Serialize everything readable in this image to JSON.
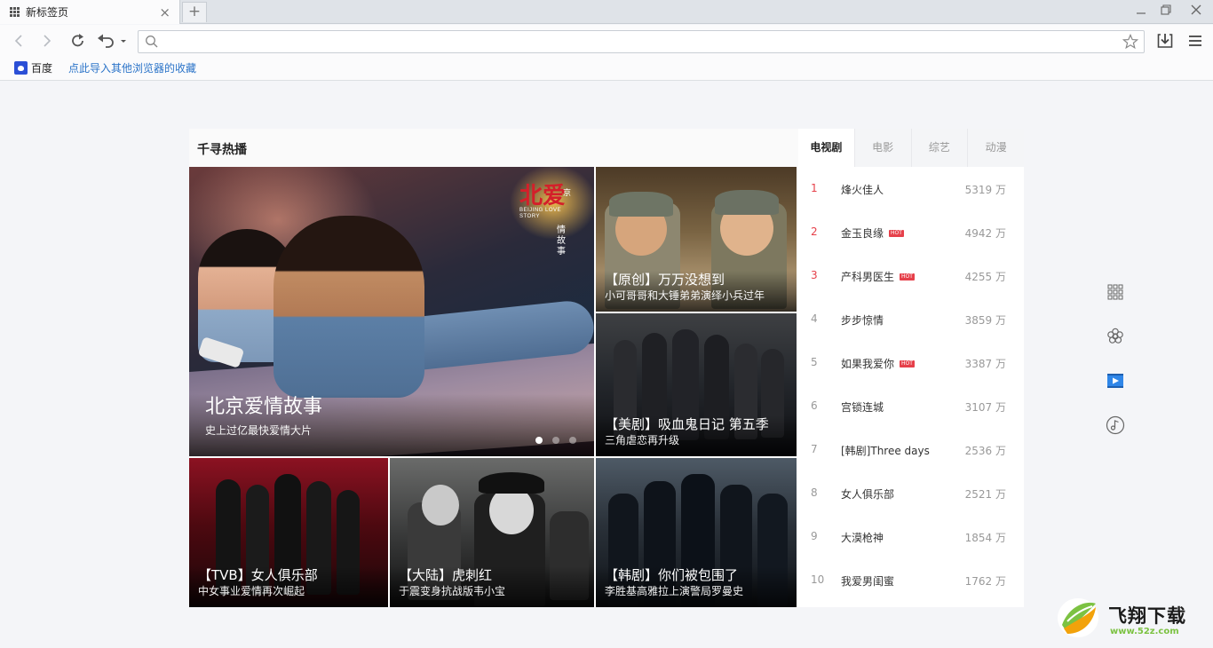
{
  "tab": {
    "title": "新标签页",
    "close": "×",
    "new": "+"
  },
  "window": {
    "minimize": "—",
    "restore": "❐",
    "close": "✕"
  },
  "address": {
    "value": "",
    "placeholder": ""
  },
  "bookmarks": [
    {
      "label": "百度"
    },
    {
      "label": "点此导入其他浏览器的收藏"
    }
  ],
  "panel": {
    "title": "千寻热播",
    "feature": {
      "title": "北京爱情故事",
      "subtitle": "史上过亿最快爱情大片",
      "logo": {
        "main": "北爱",
        "small": "京",
        "english": "BEIJING LOVE STORY",
        "vertical": "情故事"
      },
      "slides": 3,
      "active_slide": 1
    },
    "tiles": [
      {
        "title": "【原创】万万没想到",
        "subtitle": "小可哥哥和大锤弟弟演绎小兵过年"
      },
      {
        "title": "【美剧】吸血鬼日记 第五季",
        "subtitle": "三角虐恋再升级"
      },
      {
        "title": "【TVB】女人俱乐部",
        "subtitle": "中女事业爱情再次崛起"
      },
      {
        "title": "【大陆】虎刺红",
        "subtitle": "于震变身抗战版韦小宝"
      },
      {
        "title": "【韩剧】你们被包围了",
        "subtitle": "李胜基高雅拉上演警局罗曼史"
      }
    ]
  },
  "ranking": {
    "tabs": [
      "电视剧",
      "电影",
      "综艺",
      "动漫"
    ],
    "active_tab": 0,
    "items": [
      {
        "rank": "1",
        "name": "烽火佳人",
        "count": "5319 万",
        "hot": false
      },
      {
        "rank": "2",
        "name": "金玉良缘",
        "count": "4942 万",
        "hot": true
      },
      {
        "rank": "3",
        "name": "产科男医生",
        "count": "4255 万",
        "hot": true
      },
      {
        "rank": "4",
        "name": "步步惊情",
        "count": "3859 万",
        "hot": false
      },
      {
        "rank": "5",
        "name": "如果我爱你",
        "count": "3387 万",
        "hot": true
      },
      {
        "rank": "6",
        "name": "宫锁连城",
        "count": "3107 万",
        "hot": false
      },
      {
        "rank": "7",
        "name": "[韩剧]Three days",
        "count": "2536 万",
        "hot": false
      },
      {
        "rank": "8",
        "name": "女人俱乐部",
        "count": "2521 万",
        "hot": false
      },
      {
        "rank": "9",
        "name": "大漠枪神",
        "count": "1854 万",
        "hot": false
      },
      {
        "rank": "10",
        "name": "我爱男闺蜜",
        "count": "1762 万",
        "hot": false
      }
    ],
    "hot_label": "HOT"
  },
  "side_icons": [
    "apps-grid-icon",
    "flower-icon",
    "video-icon",
    "music-icon"
  ],
  "watermark": {
    "name": "飞翔下载",
    "url": "www.52z.com"
  },
  "colors": {
    "accent_red": "#e6404a",
    "link_blue": "#2a73c8",
    "video_blue": "#2f86e8"
  }
}
